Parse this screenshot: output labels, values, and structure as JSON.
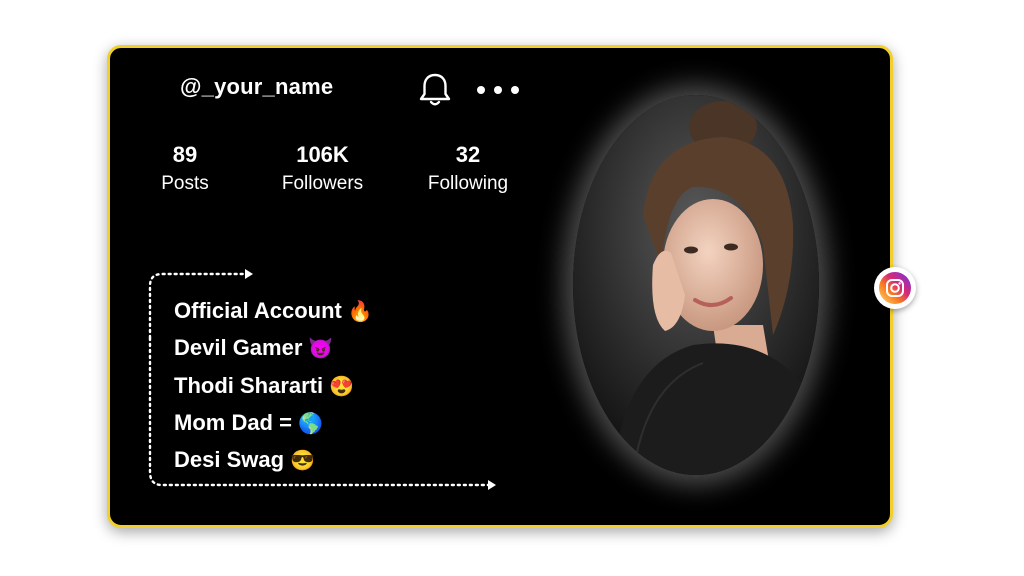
{
  "profile": {
    "username": "@_your_name",
    "stats": [
      {
        "value": "89",
        "label": "Posts"
      },
      {
        "value": "106K",
        "label": "Followers"
      },
      {
        "value": "32",
        "label": "Following"
      }
    ],
    "bio": [
      {
        "text": "Official Account",
        "emoji": "🔥"
      },
      {
        "text": "Devil Gamer",
        "emoji": "😈"
      },
      {
        "text": "Thodi Shararti",
        "emoji": "😍"
      },
      {
        "text": "Mom Dad =",
        "emoji": "🌎"
      },
      {
        "text": "Desi Swag",
        "emoji": "😎"
      }
    ]
  },
  "icons": {
    "notification": "bell-icon",
    "more": "more-dots-icon",
    "social": "instagram-icon"
  },
  "colors": {
    "card_background": "#000000",
    "card_border": "#f2cf2a",
    "text": "#ffffff",
    "page_background": "#ffffff"
  }
}
